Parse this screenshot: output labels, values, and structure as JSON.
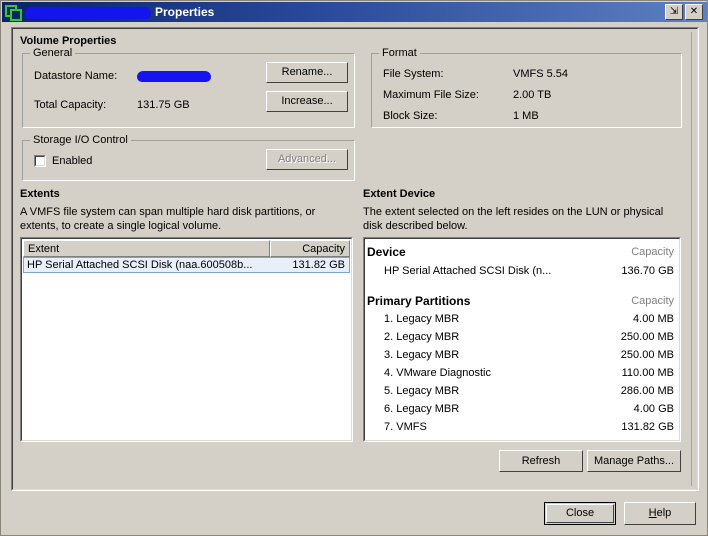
{
  "window": {
    "title_prefix": "",
    "title_suffix": "Properties",
    "icon": "vmware-datastore-icon",
    "buttons": {
      "restore": "⇲",
      "close": "✕"
    }
  },
  "volume": {
    "heading": "Volume Properties",
    "general": {
      "legend": "General",
      "datastore_name_label": "Datastore Name:",
      "datastore_name_value": "",
      "total_capacity_label": "Total Capacity:",
      "total_capacity_value": "131.75 GB",
      "rename_button": "Rename...",
      "increase_button": "Increase..."
    },
    "format": {
      "legend": "Format",
      "file_system_label": "File System:",
      "file_system_value": "VMFS 5.54",
      "max_file_size_label": "Maximum File Size:",
      "max_file_size_value": "2.00 TB",
      "block_size_label": "Block Size:",
      "block_size_value": "1 MB"
    },
    "storage_io": {
      "legend": "Storage I/O Control",
      "enabled_label": "Enabled",
      "enabled_checked": false,
      "advanced_button": "Advanced..."
    }
  },
  "extents": {
    "heading": "Extents",
    "description": "A VMFS file system can span multiple hard disk partitions, or extents, to create a single logical volume.",
    "columns": [
      "Extent",
      "Capacity"
    ],
    "rows": [
      {
        "name": "HP Serial Attached SCSI Disk (naa.600508b...",
        "capacity": "131.82 GB",
        "selected": true
      }
    ]
  },
  "extent_device": {
    "heading": "Extent Device",
    "description": "The extent selected on the left resides on the LUN or physical disk described below.",
    "device_section": {
      "header": "Device",
      "capacity_header": "Capacity",
      "items": [
        {
          "name": "HP Serial Attached SCSI Disk (n...",
          "capacity": "136.70 GB"
        }
      ]
    },
    "partitions_section": {
      "header": "Primary Partitions",
      "capacity_header": "Capacity",
      "items": [
        {
          "name": "1. Legacy MBR",
          "capacity": "4.00 MB"
        },
        {
          "name": "2. Legacy MBR",
          "capacity": "250.00 MB"
        },
        {
          "name": "3. Legacy MBR",
          "capacity": "250.00 MB"
        },
        {
          "name": "4. VMware Diagnostic",
          "capacity": "110.00 MB"
        },
        {
          "name": "5. Legacy MBR",
          "capacity": "286.00 MB"
        },
        {
          "name": "6. Legacy MBR",
          "capacity": "4.00 GB"
        },
        {
          "name": "7. VMFS",
          "capacity": "131.82 GB"
        }
      ]
    },
    "refresh_button": "Refresh",
    "manage_paths_button": "Manage Paths..."
  },
  "footer": {
    "close_button": "Close",
    "help_button_prefix": "H",
    "help_button_rest": "elp"
  },
  "colors": {
    "window_face": "#d4d0c8",
    "title_left": "#0a246a",
    "title_right": "#5d80c1",
    "redaction": "#1414ee",
    "selection_fill": "#e8eff9",
    "selection_border": "#7da2ce",
    "muted_text": "#808080"
  }
}
